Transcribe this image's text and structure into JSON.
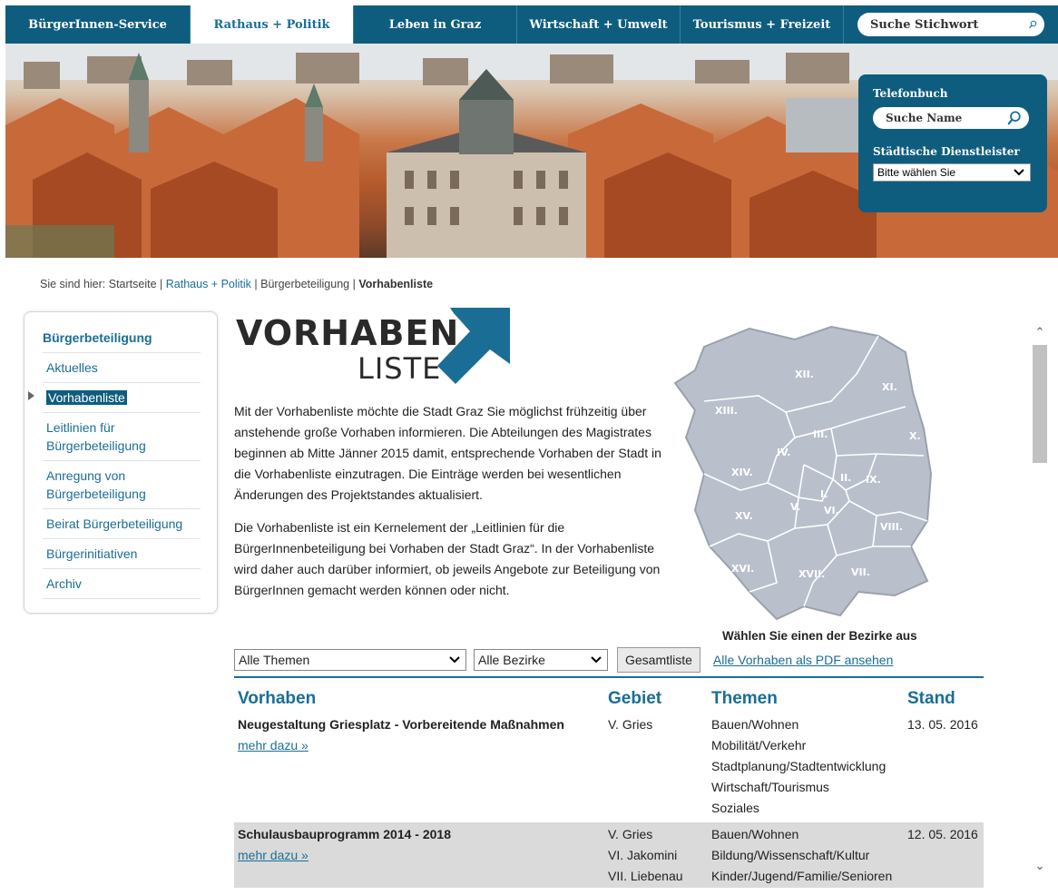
{
  "nav": {
    "tabs": [
      {
        "label": "BürgerInnen-Service"
      },
      {
        "label": "Rathaus + Politik"
      },
      {
        "label": "Leben in Graz"
      },
      {
        "label": "Wirtschaft + Umwelt"
      },
      {
        "label": "Tourismus + Freizeit"
      }
    ],
    "search_placeholder": "Suche Stichwort"
  },
  "phonebook": {
    "title": "Telefonbuch",
    "name_placeholder": "Suche Name",
    "services_label": "Städtische Dienstleister",
    "services_selected": "Bitte wählen Sie"
  },
  "breadcrumb": {
    "prefix": "Sie sind hier:",
    "items": [
      "Startseite",
      "Rathaus + Politik",
      "Bürgerbeteiligung",
      "Vorhabenliste"
    ]
  },
  "sidebar": {
    "heading": "Bürgerbeteiligung",
    "items": [
      {
        "label": "Aktuelles"
      },
      {
        "label": "Vorhabenliste"
      },
      {
        "label": "Leitlinien für Bürgerbeteiligung"
      },
      {
        "label": "Anregung von Bürgerbeteiligung"
      },
      {
        "label": "Beirat Bürgerbeteiligung"
      },
      {
        "label": "Bürgerinitiativen"
      },
      {
        "label": "Archiv"
      }
    ]
  },
  "logo": {
    "line1": "VORHABEN",
    "line2": "LISTE"
  },
  "intro": {
    "p1": "Mit der Vorhabenliste möchte die Stadt Graz Sie möglichst frühzeitig über anstehende große Vorhaben informieren. Die Abteilungen des Magistrates beginnen ab Mitte Jänner 2015 damit, entsprechende Vorhaben der Stadt in die Vorhabenliste einzutragen. Die Einträge werden bei wesentlichen Änderungen des Projektstandes aktualisiert.",
    "p2": "Die Vorhabenliste ist ein Kernelement der „Leitlinien für die BürgerInnenbeteiligung bei Vorhaben der Stadt Graz“. In der Vorhabenliste wird daher auch darüber informiert, ob jeweils Angebote zur Beteiligung von BürgerInnen  gemacht werden können oder nicht."
  },
  "map": {
    "districts": [
      "I.",
      "II.",
      "III.",
      "IV.",
      "V.",
      "VI.",
      "VII.",
      "VIII.",
      "IX.",
      "X.",
      "XI.",
      "XII.",
      "XIII.",
      "XIV.",
      "XV.",
      "XVI.",
      "XVII."
    ],
    "caption": "Wählen Sie einen der Bezirke aus"
  },
  "filters": {
    "themes_selected": "Alle Themen",
    "districts_selected": "Alle Bezirke",
    "full_list_label": "Gesamtliste",
    "pdf_link": "Alle Vorhaben als PDF ansehen"
  },
  "table": {
    "headers": [
      "Vorhaben",
      "Gebiet",
      "Themen",
      "Stand"
    ],
    "more_label": "mehr dazu »",
    "rows": [
      {
        "title": "Neugestaltung Griesplatz - Vorbereitende Maßnahmen",
        "areas": [
          "V. Gries"
        ],
        "themes": [
          "Bauen/Wohnen",
          "Mobilität/Verkehr",
          "Stadtplanung/Stadtentwicklung",
          "Wirtschaft/Tourismus",
          "Soziales"
        ],
        "date": "13. 05. 2016"
      },
      {
        "title": "Schulausbauprogramm 2014 - 2018",
        "areas": [
          "V. Gries",
          "VI. Jakomini",
          "VII. Liebenau"
        ],
        "themes": [
          "Bauen/Wohnen",
          "Bildung/Wissenschaft/Kultur",
          "Kinder/Jugend/Familie/Senioren"
        ],
        "date": "12. 05. 2016"
      }
    ]
  },
  "colors": {
    "brand": "#0e5d7f",
    "link": "#1a6e96",
    "logo_arrow": "#1a6e96",
    "map_fill": "#b9c0cc"
  }
}
